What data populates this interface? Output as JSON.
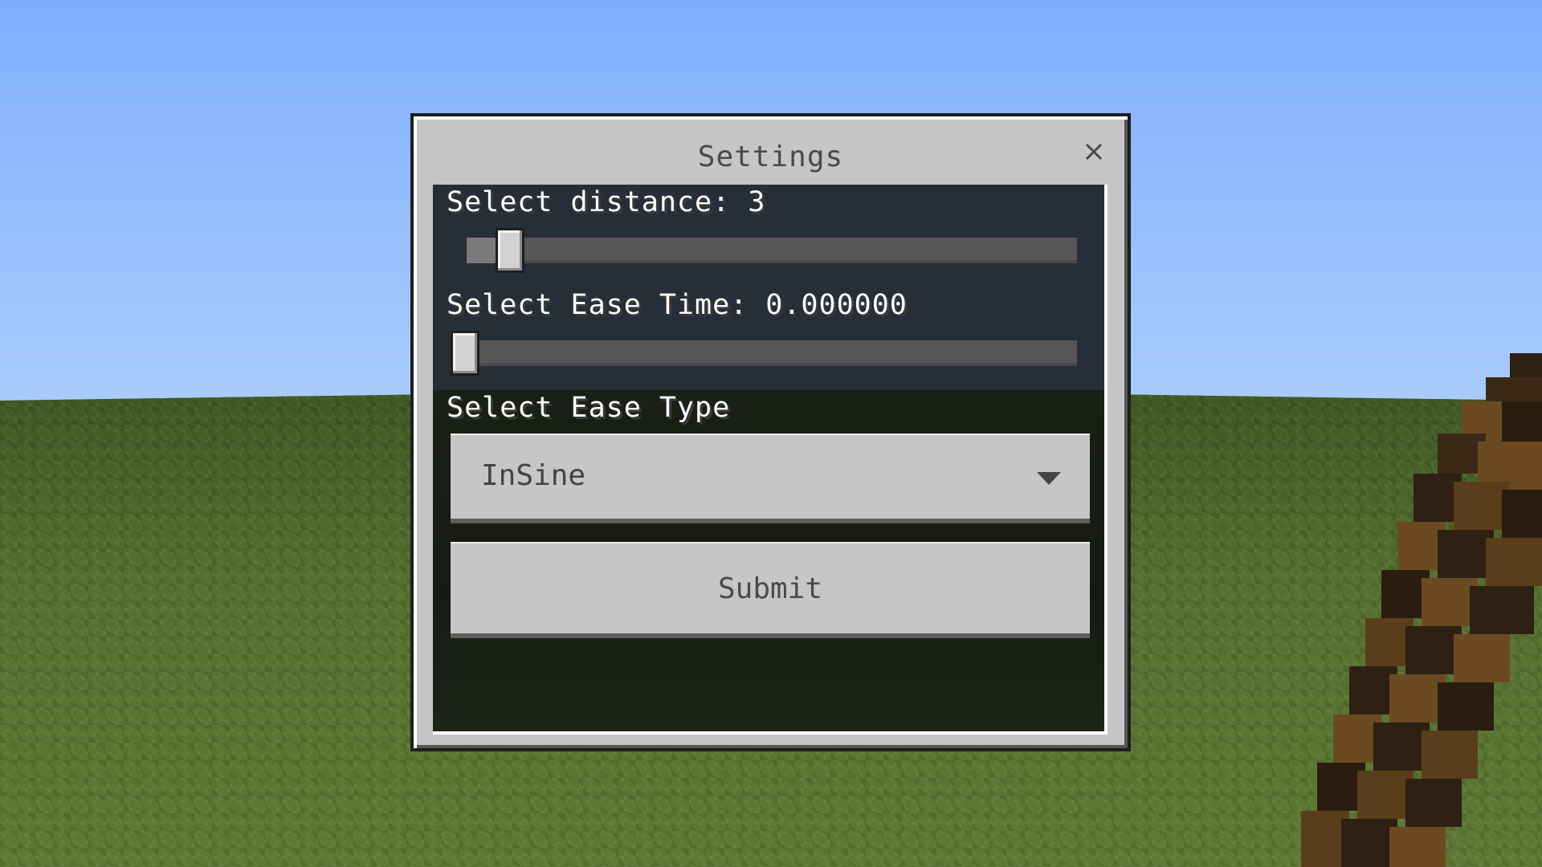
{
  "dialog": {
    "title": "Settings",
    "close_icon": "close-icon"
  },
  "sliders": {
    "distance": {
      "label": "Select distance: 3",
      "value": 3,
      "fraction": 0.05
    },
    "ease_time": {
      "label": "Select Ease Time: 0.000000",
      "value": 0.0,
      "fraction": 0.0
    }
  },
  "ease_type": {
    "label": "Select Ease Type",
    "selected": "InSine",
    "arrow_icon": "chevron-down-icon"
  },
  "submit": {
    "label": "Submit"
  },
  "colors": {
    "sky": "#8ab6fc",
    "grass": "#4f6a2c",
    "panel": "#c6c6c6",
    "content_bg": "#262e38",
    "item_dark": "#2e2013",
    "item_light": "#6b4a22"
  }
}
